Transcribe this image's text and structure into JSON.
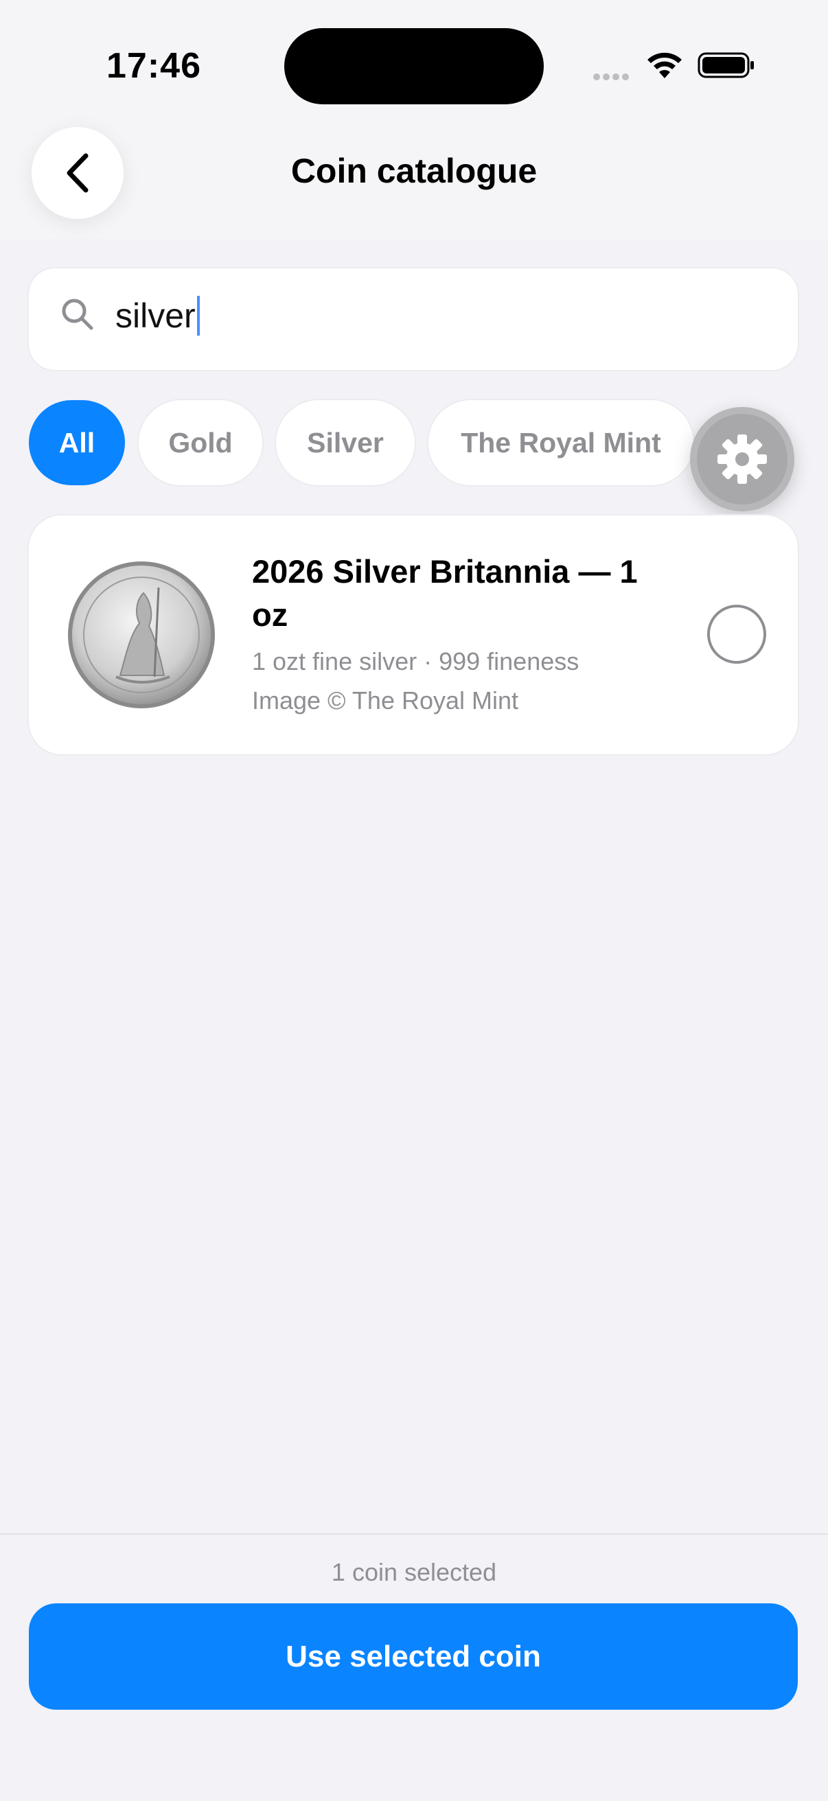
{
  "status_bar": {
    "time": "17:46"
  },
  "header": {
    "title": "Coin catalogue"
  },
  "search": {
    "value": "silver"
  },
  "filters": [
    {
      "label": "All",
      "active": true
    },
    {
      "label": "Gold",
      "active": false
    },
    {
      "label": "Silver",
      "active": false
    },
    {
      "label": "The Royal Mint",
      "active": false
    }
  ],
  "coins": [
    {
      "title": "2026 Silver Britannia — 1 oz",
      "subtitle": "1 ozt fine silver · 999 fineness",
      "credit": "Image © The Royal Mint",
      "selected": false
    }
  ],
  "footer": {
    "selection_count": "1 coin selected",
    "use_button": "Use selected coin"
  },
  "colors": {
    "accent": "#0a84ff",
    "background": "#f2f2f7"
  }
}
